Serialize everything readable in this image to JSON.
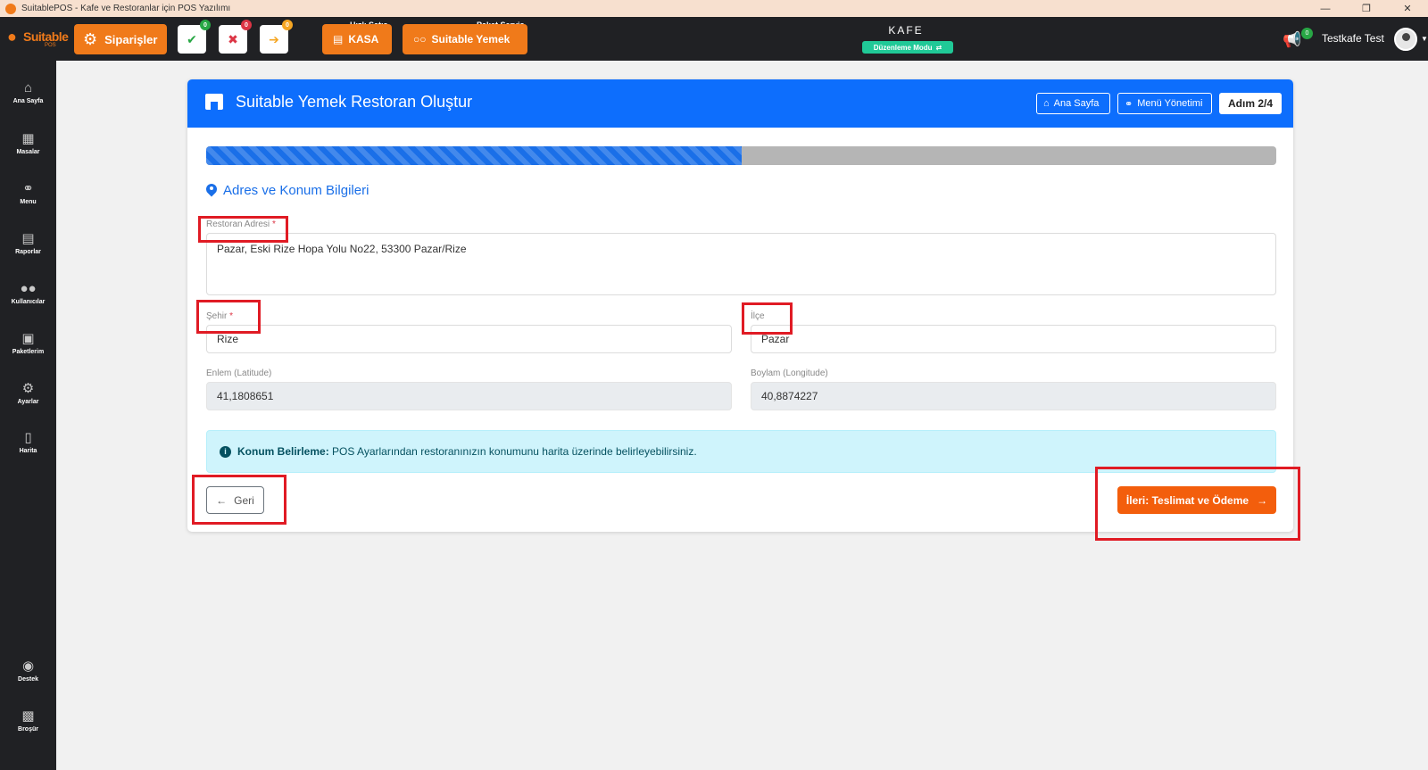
{
  "window": {
    "title": "SuitablePOS - Kafe ve Restoranlar için POS Yazılımı",
    "controls": [
      "—",
      "❐",
      "✕"
    ]
  },
  "topnav": {
    "logo_text": "Suitable",
    "logo_sub": "POS",
    "siparisler_label": "Siparişler",
    "status_buttons": [
      {
        "symbol": "✔",
        "count": "0",
        "color": "#28a745",
        "badge_color": "#28a745"
      },
      {
        "symbol": "✖",
        "count": "0",
        "color": "#dc3545",
        "badge_color": "#dc3545"
      },
      {
        "symbol": "➔",
        "count": "0",
        "color": "#f5a623",
        "badge_color": "#f5a623"
      }
    ],
    "kasa_caption": "Hızlı Satış",
    "kasa_label": "KASA",
    "yemek_caption": "Paket Servis",
    "yemek_label": "Suitable Yemek",
    "business_name": "KAFE",
    "mode_label": "Düzenleme Modu",
    "notifications_count": "0",
    "user_name": "Testkafe Test"
  },
  "sidebar": {
    "items": [
      {
        "label": "Ana Sayfa",
        "icon": "home-icon"
      },
      {
        "label": "Masalar",
        "icon": "table-icon"
      },
      {
        "label": "Menu",
        "icon": "utensils-icon"
      },
      {
        "label": "Raporlar",
        "icon": "report-icon"
      },
      {
        "label": "Kullanıcılar",
        "icon": "users-icon"
      },
      {
        "label": "Paketlerim",
        "icon": "gift-icon"
      },
      {
        "label": "Ayarlar",
        "icon": "cogs-icon"
      },
      {
        "label": "Harita",
        "icon": "map-icon"
      }
    ],
    "bottom_items": [
      {
        "label": "Destek",
        "icon": "chat-icon"
      },
      {
        "label": "Broşür",
        "icon": "brochure-icon"
      }
    ]
  },
  "card": {
    "title": "Suitable Yemek Restoran Oluştur",
    "home_button": "Ana Sayfa",
    "menu_button": "Menü Yönetimi",
    "step": "Adım 2/4",
    "progress": 0.5,
    "section_title": "Adres ve Konum Bilgileri",
    "address_label": "Restoran Adresi",
    "address_value": "Pazar, Eski Rize Hopa Yolu No22, 53300 Pazar/Rize",
    "city_label": "Şehir",
    "city_value": "Rize",
    "district_label": "İlçe",
    "district_value": "Pazar",
    "lat_label": "Enlem (Latitude)",
    "lat_value": "41,1808651",
    "lng_label": "Boylam (Longitude)",
    "lng_value": "40,8874227",
    "info_title": "Konum Belirleme:",
    "info_text": " POS Ayarlarından restoranınızın konumunu harita üzerinde belirleyebilirsiniz.",
    "back_button": "Geri",
    "next_button": "İleri: Teslimat ve Ödeme"
  },
  "colors": {
    "primary": "#0d6efd",
    "accent": "#f07a1a",
    "next": "#f35e0c",
    "highlight": "#e01b24"
  }
}
